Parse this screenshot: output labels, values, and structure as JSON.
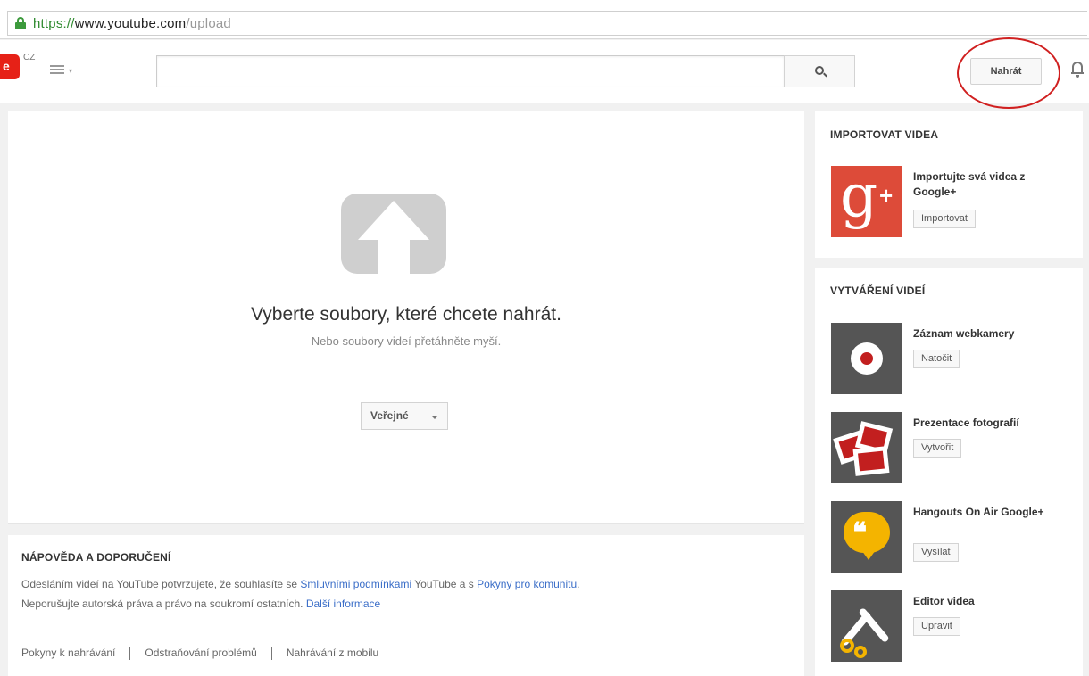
{
  "browser": {
    "url_scheme": "https://",
    "url_host": "www.youtube.com",
    "url_path": "/upload"
  },
  "header": {
    "logo_letter": "e",
    "country": "CZ",
    "upload_label": "Nahrát"
  },
  "upload": {
    "title": "Vyberte soubory, které chcete nahrát.",
    "subtitle": "Nebo soubory videí přetáhněte myší.",
    "privacy_label": "Veřejné"
  },
  "help": {
    "title": "NÁPOVĚDA A DOPORUČENÍ",
    "line1_a": "Odesláním videí na YouTube potvrzujete, že souhlasíte se ",
    "line1_link1": "Smluvními podmínkami",
    "line1_b": " YouTube a s ",
    "line1_link2": "Pokyny pro komunitu",
    "line1_c": ".",
    "line2_a": "Neporušujte autorská práva a právo na soukromí ostatních. ",
    "line2_link": "Další informace",
    "links": [
      "Pokyny k nahrávání",
      "Odstraňování problémů",
      "Nahrávání z mobilu"
    ]
  },
  "import": {
    "title": "IMPORTOVAT VIDEA",
    "item_label": "Importujte svá videa z Google+",
    "item_button": "Importovat",
    "gplus_letter": "g",
    "gplus_plus": "+"
  },
  "create": {
    "title": "VYTVÁŘENÍ VIDEÍ",
    "items": [
      {
        "label": "Záznam webkamery",
        "button": "Natočit"
      },
      {
        "label": "Prezentace fotografií",
        "button": "Vytvořit"
      },
      {
        "label": "Hangouts On Air Google+",
        "button": "Vysílat"
      },
      {
        "label": "Editor videa",
        "button": "Upravit"
      }
    ],
    "hangouts_glyph": "❝"
  },
  "colors": {
    "brand_red": "#e62117",
    "gplus_red": "#dd4b39",
    "link_blue": "#3b6ec8",
    "annotation_red": "#d02020"
  },
  "icons": [
    "lock-icon",
    "menu-icon",
    "search-icon",
    "bell-icon",
    "upload-arrow-icon",
    "webcam-icon",
    "photos-icon",
    "hangouts-icon",
    "scissors-icon"
  ]
}
